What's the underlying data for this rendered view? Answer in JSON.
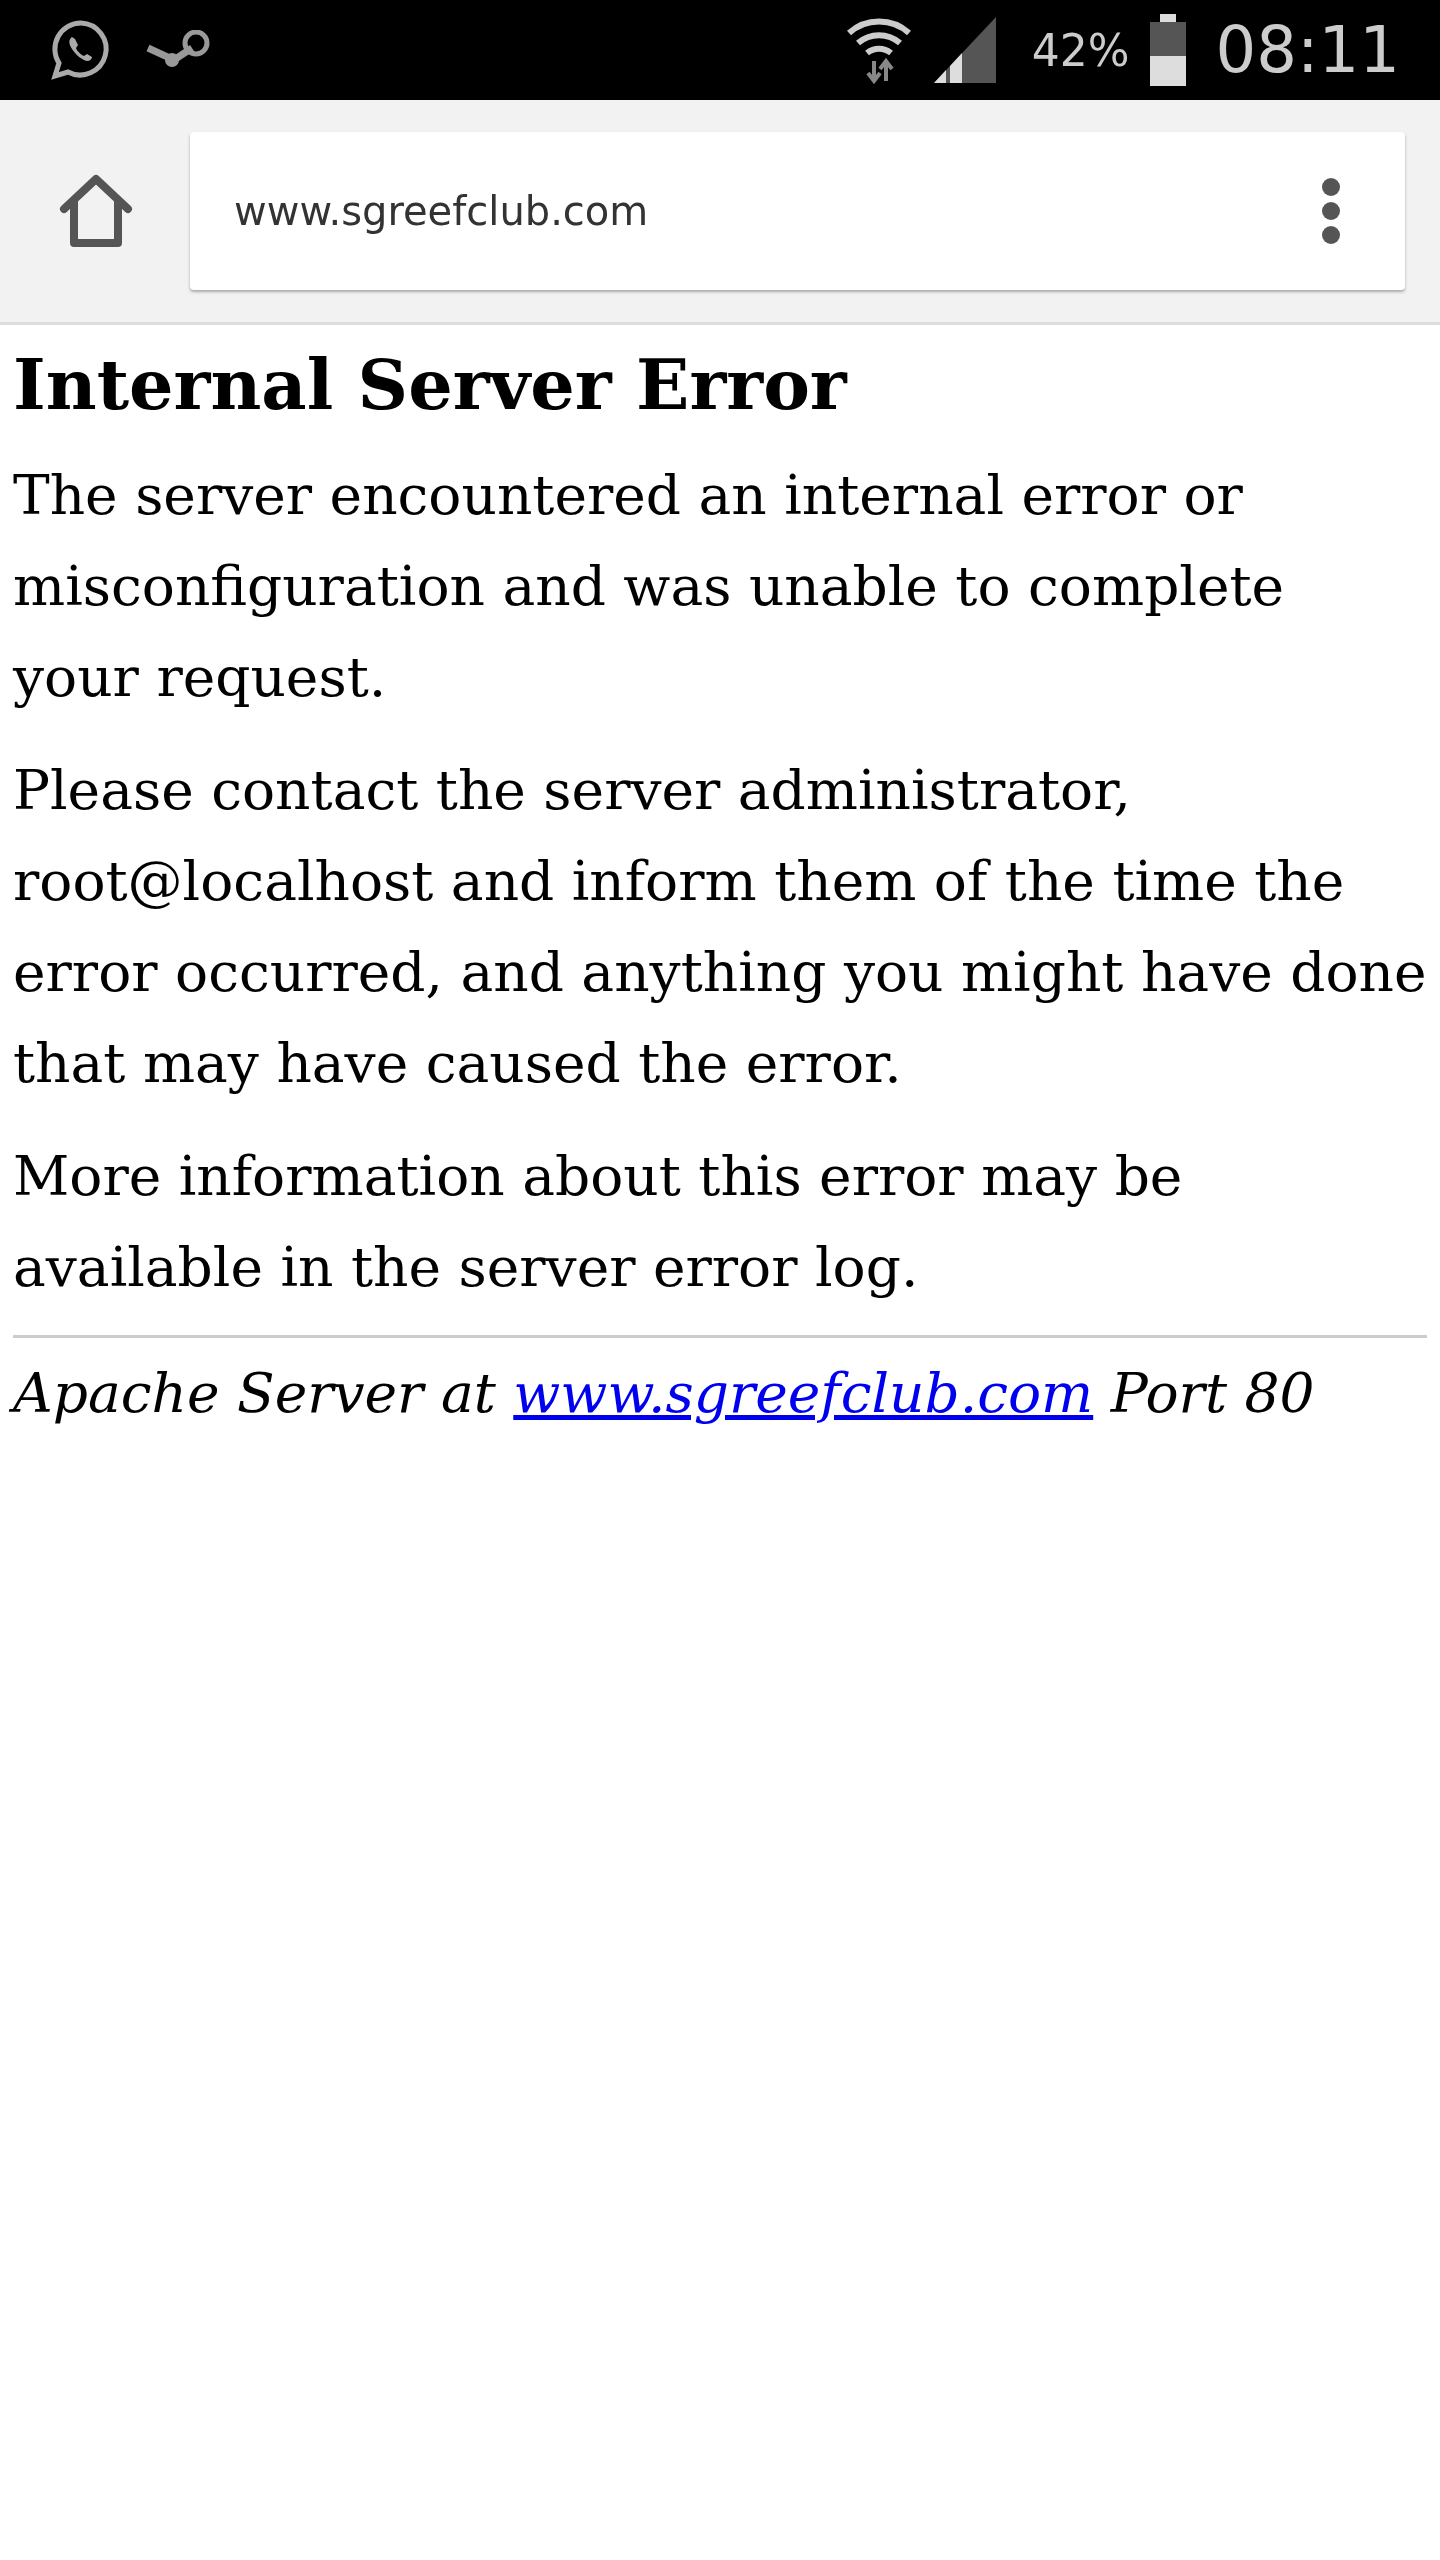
{
  "status_bar": {
    "battery": "42%",
    "time": "08:11"
  },
  "browser": {
    "url": "www.sgreefclub.com"
  },
  "page": {
    "title": "Internal Server Error",
    "paragraphs": [
      "The server encountered an internal error or misconfiguration and was unable to complete your request.",
      "Please contact the server administrator, root@localhost and inform them of the time the error occurred, and anything you might have done that may have caused the error.",
      "More information about this error may be available in the server error log."
    ],
    "footer": {
      "prefix": "Apache Server at",
      "link": "www.sgreefclub.com",
      "suffix": "Port 80"
    }
  }
}
